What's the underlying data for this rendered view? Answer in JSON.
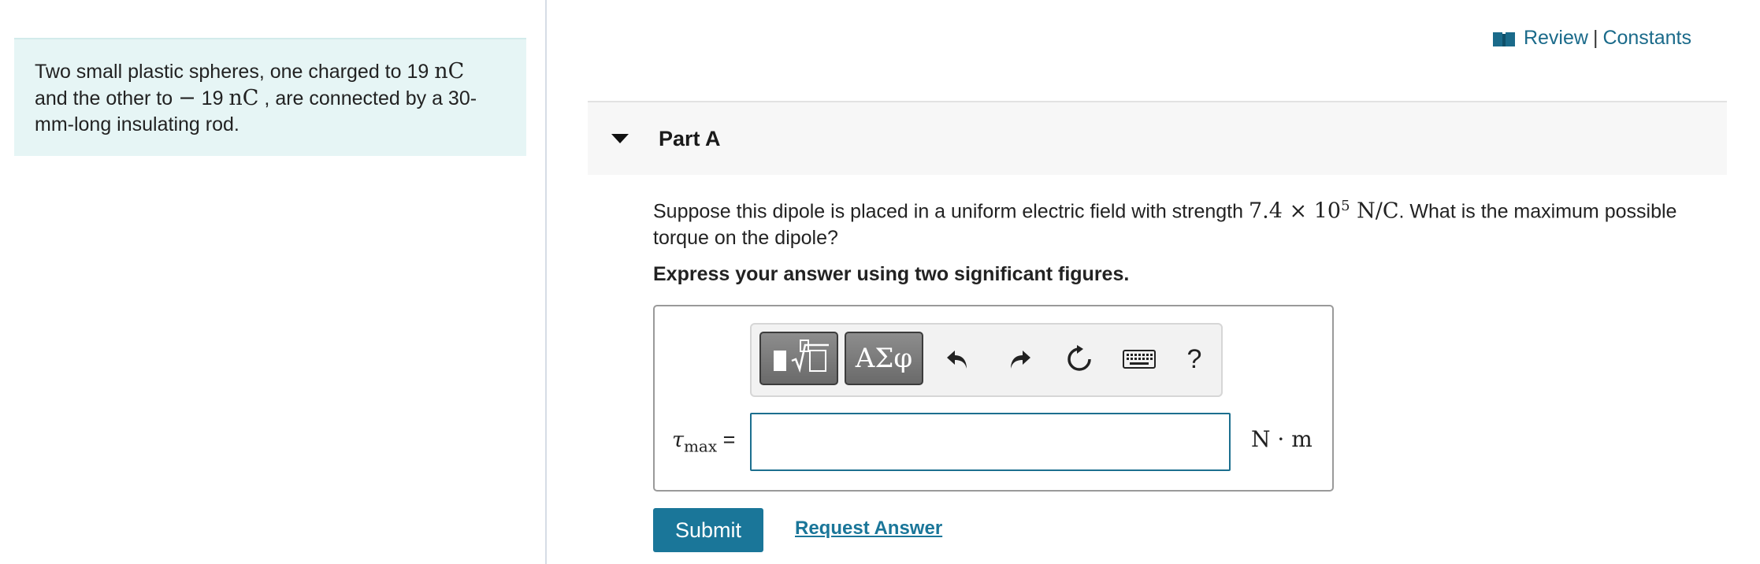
{
  "problem": {
    "line1_text": "Two small plastic spheres, one charged to 19 ",
    "line1_unit": "nC",
    "line2_text_a": "and the other to ",
    "line2_sign": "−",
    "line2_text_b": " 19 ",
    "line2_unit": "nC",
    "line2_text_c": " , are connected by a 30-",
    "line3_text": "mm-long insulating rod."
  },
  "header_links": {
    "icon": "book-icon",
    "review": "Review",
    "separator": "|",
    "constants": "Constants"
  },
  "part": {
    "title": "Part A",
    "expanded": true
  },
  "question": {
    "text_before": "Suppose this dipole is placed in a uniform electric field with strength ",
    "field_mantissa": "7.4",
    "times": "×",
    "field_base": "10",
    "field_exponent": "5",
    "field_unit": "N/C",
    "text_after": ". What is the maximum possible torque on the dipole?",
    "instruction": "Express your answer using two significant figures."
  },
  "toolbar": {
    "templates_icon": "templates-icon",
    "symbols_label": "ΑΣφ",
    "undo_icon": "undo-icon",
    "redo_icon": "redo-icon",
    "reset_icon": "reset-icon",
    "keyboard_icon": "keyboard-icon",
    "help_label": "?"
  },
  "answer": {
    "variable": "τ",
    "variable_subscript": "max",
    "equals": "=",
    "value": "",
    "unit": "N · m"
  },
  "actions": {
    "submit_label": "Submit",
    "request_label": "Request Answer"
  },
  "colors": {
    "accent": "#1a7699",
    "link": "#1a6a8a",
    "problem_bg": "#e6f5f5",
    "part_header_bg": "#f7f7f7"
  }
}
